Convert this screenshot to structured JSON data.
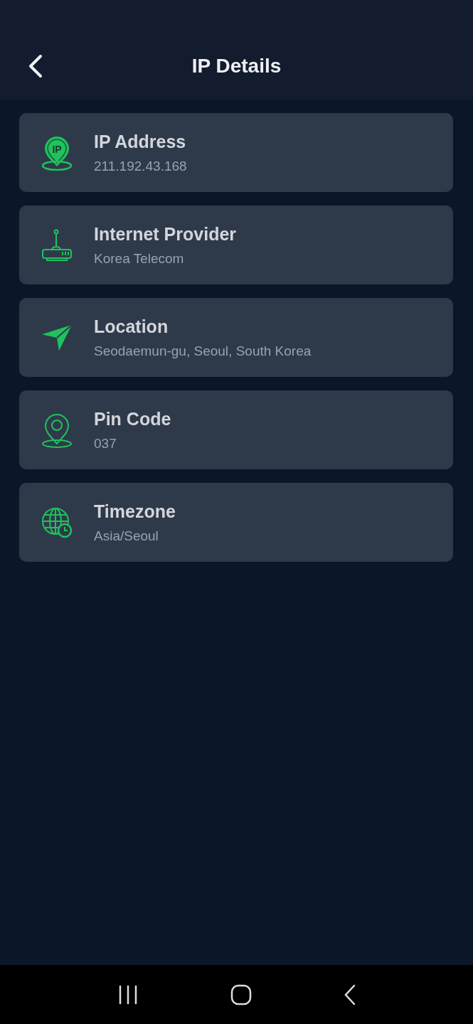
{
  "header": {
    "title": "IP Details"
  },
  "details": [
    {
      "kind": "ip",
      "icon_text": "IP",
      "label": "IP Address",
      "value": "211.192.43.168"
    },
    {
      "kind": "router",
      "label": "Internet Provider",
      "value": "Korea Telecom"
    },
    {
      "kind": "location",
      "label": "Location",
      "value": "Seodaemun-gu, Seoul, South Korea"
    },
    {
      "kind": "pin",
      "label": "Pin Code",
      "value": "037"
    },
    {
      "kind": "timezone",
      "label": "Timezone",
      "value": "Asia/Seoul"
    }
  ]
}
